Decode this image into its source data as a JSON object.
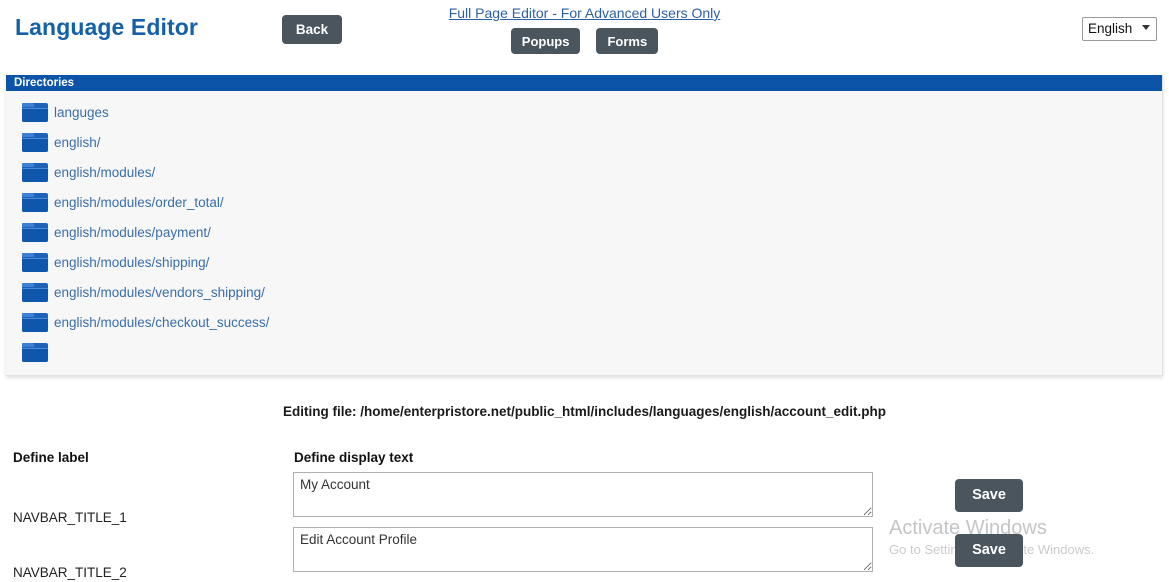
{
  "header": {
    "app_title": "Language Editor",
    "back_label": "Back",
    "fullpage_link": "Full Page Editor - For Advanced Users Only",
    "popups_label": "Popups",
    "forms_label": "Forms",
    "language_selected": "English",
    "language_options": [
      "English"
    ],
    "accent_blue": "#1461a8",
    "button_dark": "#4a555e"
  },
  "directories": {
    "panel_title": "Directories",
    "header_bg": "#0b54a8",
    "link_color": "#3a6ea8",
    "items": [
      {
        "label": "languges"
      },
      {
        "label": "english/"
      },
      {
        "label": "english/modules/"
      },
      {
        "label": "english/modules/order_total/"
      },
      {
        "label": "english/modules/payment/"
      },
      {
        "label": "english/modules/shipping/"
      },
      {
        "label": "english/modules/vendors_shipping/"
      },
      {
        "label": "english/modules/checkout_success/"
      },
      {
        "label": ""
      }
    ]
  },
  "editor": {
    "editing_file": "Editing file: /home/enterpristore.net/public_html/includes/languages/english/account_edit.php",
    "column_label_head": "Define label",
    "column_text_head": "Define display text",
    "save_label": "Save",
    "rows": [
      {
        "label": "NAVBAR_TITLE_1",
        "value": "My Account",
        "save_label": "Save"
      },
      {
        "label": "NAVBAR_TITLE_2",
        "value": "Edit Account Profile",
        "save_label": "Save"
      }
    ]
  },
  "watermark": {
    "title": "Activate Windows",
    "subtitle": "Go to Settings to activate Windows."
  }
}
